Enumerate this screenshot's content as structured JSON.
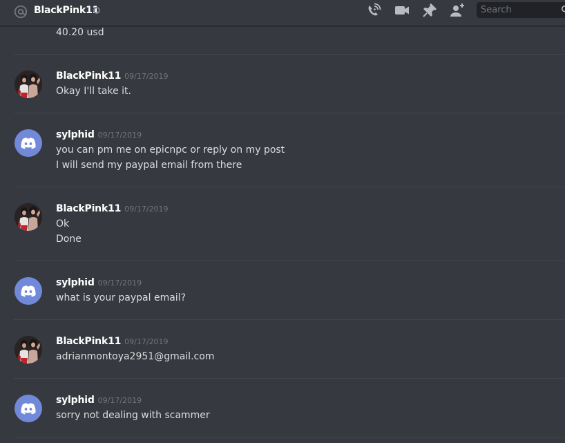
{
  "header": {
    "channel_name": "BlackPink11",
    "status": "offline",
    "icons": [
      "at-icon",
      "voice-call-icon",
      "video-call-icon",
      "pinned-messages-icon",
      "add-friend-icon"
    ],
    "search": {
      "placeholder": "Search",
      "value": ""
    }
  },
  "messages": {
    "continued_text": "40.20 usd",
    "groups": [
      {
        "author": "BlackPink11",
        "avatar": "photo",
        "timestamp": "09/17/2019",
        "lines": [
          "Okay I'll take it."
        ]
      },
      {
        "author": "sylphid",
        "avatar": "discord-default",
        "timestamp": "09/17/2019",
        "lines": [
          "you can pm me on epicnpc or reply on my post",
          "I will send my paypal email from there"
        ]
      },
      {
        "author": "BlackPink11",
        "avatar": "photo",
        "timestamp": "09/17/2019",
        "lines": [
          "Ok",
          "Done"
        ]
      },
      {
        "author": "sylphid",
        "avatar": "discord-default",
        "timestamp": "09/17/2019",
        "lines": [
          "what is your paypal email?"
        ]
      },
      {
        "author": "BlackPink11",
        "avatar": "photo",
        "timestamp": "09/17/2019",
        "lines": [
          "adrianmontoya2951@gmail.com"
        ]
      },
      {
        "author": "sylphid",
        "avatar": "discord-default",
        "timestamp": "09/17/2019",
        "lines": [
          "sorry not dealing with scammer"
        ]
      }
    ]
  },
  "colors": {
    "background": "#36393f",
    "blurple": "#7289da",
    "username": "#ffffff",
    "text": "#dcddde",
    "timestamp": "#72767d"
  }
}
